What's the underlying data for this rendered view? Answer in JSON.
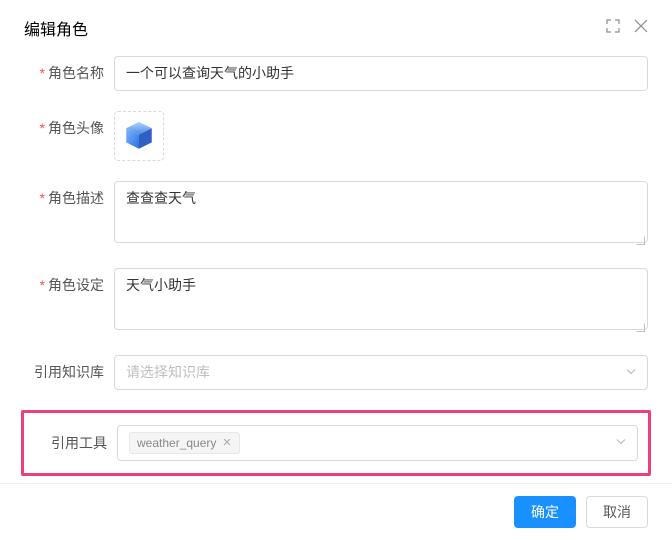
{
  "header": {
    "title": "编辑角色"
  },
  "form": {
    "name": {
      "label": "角色名称",
      "value": "一个可以查询天气的小助手",
      "required": true
    },
    "avatar": {
      "label": "角色头像",
      "required": true
    },
    "description": {
      "label": "角色描述",
      "value": "查查查天气",
      "required": true
    },
    "setting": {
      "label": "角色设定",
      "value": "天气小助手",
      "required": true
    },
    "knowledge": {
      "label": "引用知识库",
      "placeholder": "请选择知识库",
      "required": false
    },
    "tools": {
      "label": "引用工具",
      "required": false,
      "tags": [
        "weather_query"
      ]
    }
  },
  "footer": {
    "confirm": "确定",
    "cancel": "取消"
  }
}
